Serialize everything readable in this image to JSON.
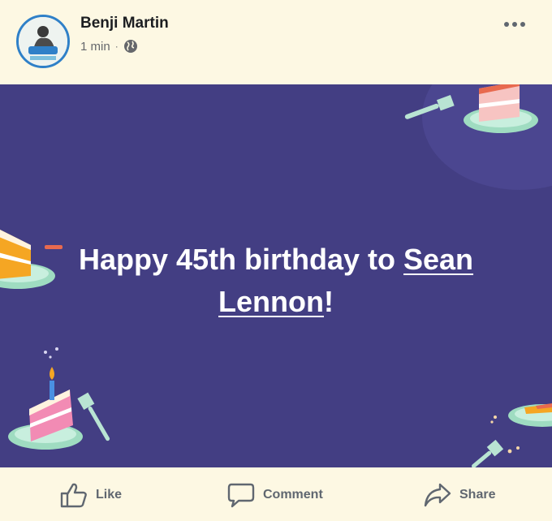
{
  "post": {
    "author": "Benji Martin",
    "time": "1 min",
    "separator": "·",
    "privacy_icon": "globe-icon",
    "more_icon": "more-options-icon"
  },
  "banner": {
    "background_color": "#433e83",
    "message_prefix": "Happy 45th birthday to ",
    "mention": "Sean Lennon",
    "message_suffix": "!"
  },
  "actions": {
    "like_label": "Like",
    "comment_label": "Comment",
    "share_label": "Share"
  }
}
